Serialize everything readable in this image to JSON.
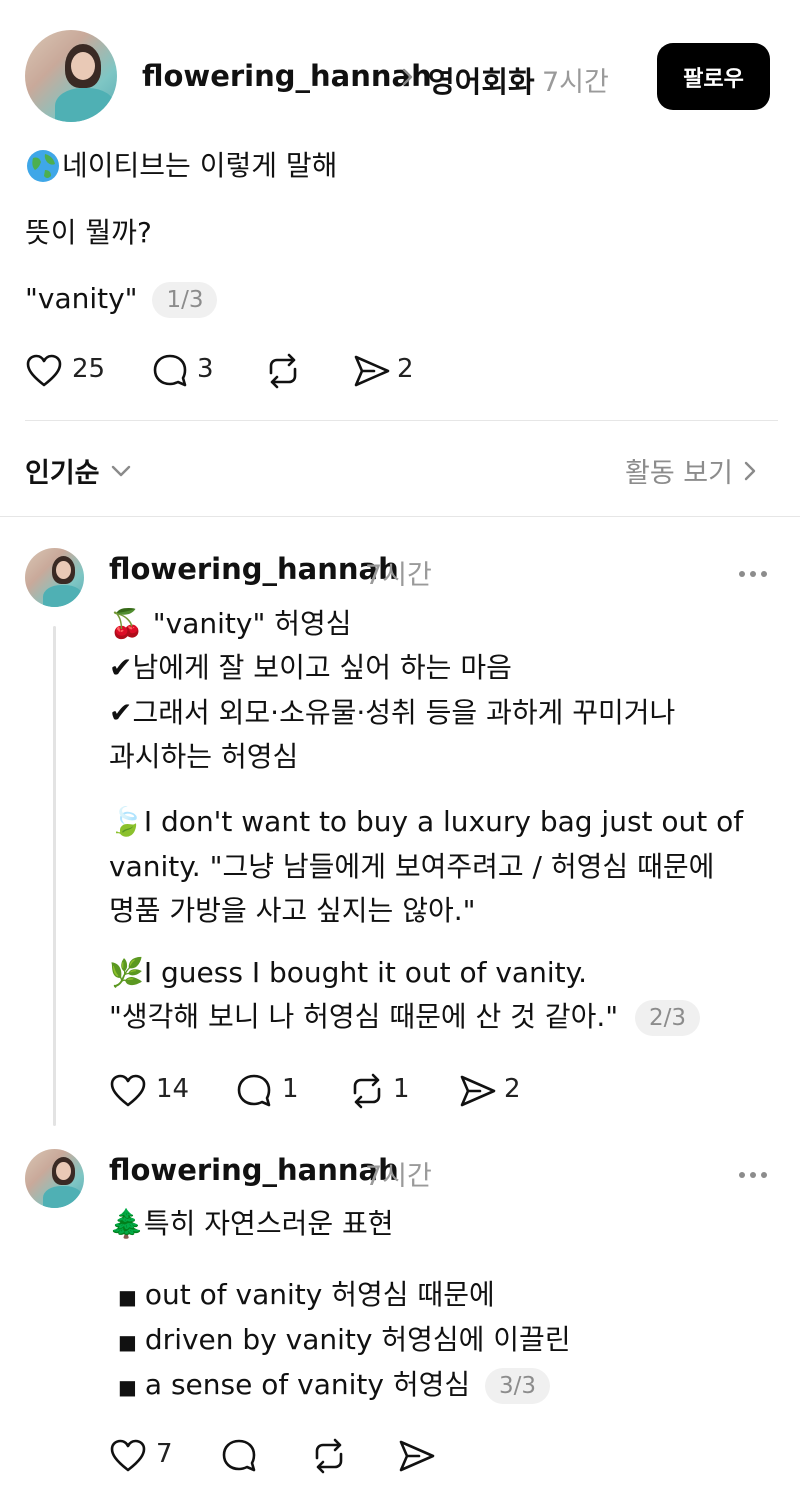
{
  "post": {
    "username": "flowering_hannah",
    "community": "영어회화",
    "time": "7시간",
    "follow_label": "팔로우",
    "line1": "네이티브는 이렇게 말해",
    "line2": "뜻이 뭘까?",
    "line3": "\"vanity\"",
    "pager": "1/3",
    "likes": "25",
    "comments": "3",
    "shares": "2"
  },
  "sort": {
    "label": "인기순",
    "activity": "활동 보기"
  },
  "reply1": {
    "username": "flowering_hannah",
    "time": "7시간",
    "lines": [
      "\"vanity\" 허영심",
      "남에게 잘 보이고 싶어 하는 마음",
      "그래서 외모·소유물·성취 등을 과하게 꾸미거나",
      "과시하는 허영심",
      "I don't want to buy a luxury bag just out of",
      "vanity. \"그냥 남들에게 보여주려고 / 허영심 때문에",
      "명품 가방을 사고 싶지는 않아.\"",
      "I guess I bought it out of vanity.",
      "\"생각해 보니 나 허영심 때문에 산 것 같아.\""
    ],
    "pager": "2/3",
    "likes": "14",
    "comments": "1",
    "reposts": "1",
    "shares": "2"
  },
  "reply2": {
    "username": "flowering_hannah",
    "time": "7시간",
    "title": "특히 자연스러운 표현",
    "bullets": [
      "out of vanity  허영심 때문에",
      "driven by vanity 허영심에 이끌린",
      "a sense of vanity 허영심"
    ],
    "pager": "3/3",
    "likes": "7"
  },
  "icons": {
    "globe": "globe-icon",
    "cherry": "cherries-icon",
    "check": "heavy-check-icon",
    "leaf": "leaf-icon",
    "herb": "herb-icon",
    "tree": "evergreen-tree-icon"
  }
}
